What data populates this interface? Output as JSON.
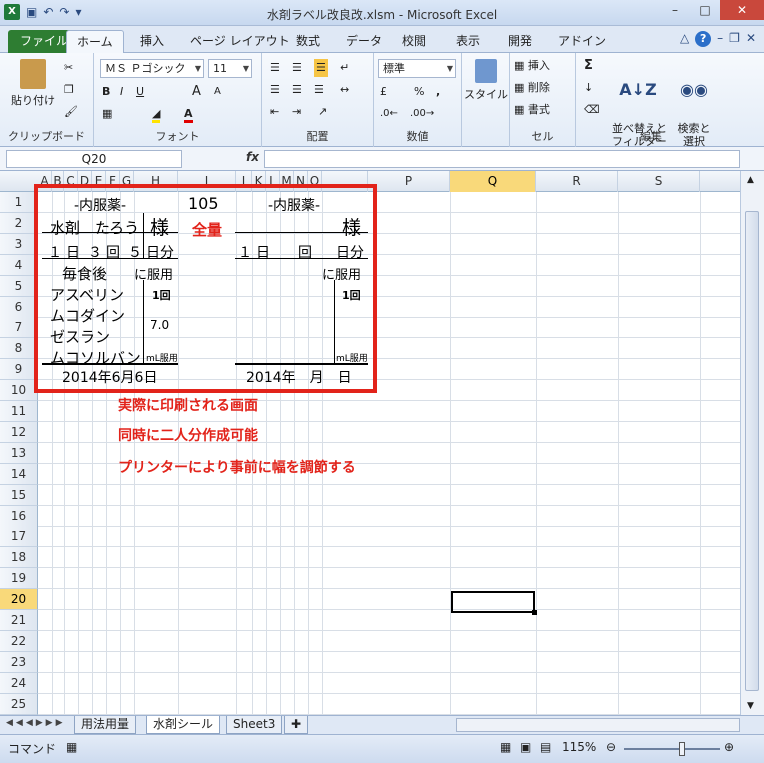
{
  "window": {
    "title": "水剤ラベル改良改.xlsm - Microsoft Excel",
    "app_icon": "X"
  },
  "qat": {
    "undo": "↶",
    "redo": "↷",
    "more": "▾"
  },
  "window_buttons": {
    "min": "–",
    "max": "□",
    "close": "✕"
  },
  "ribbon_tabs": [
    "ファイル",
    "ホーム",
    "挿入",
    "ページ レイアウト",
    "数式",
    "データ",
    "校閲",
    "表示",
    "開発",
    "アドイン"
  ],
  "ribbon": {
    "clipboard": {
      "title": "クリップボード",
      "paste": "貼り付け"
    },
    "font": {
      "title": "フォント",
      "name": "ＭＳ Ｐゴシック",
      "size": "11",
      "bold": "B",
      "italic": "I",
      "underline": "U",
      "grow": "A",
      "shrink": "A"
    },
    "align": {
      "title": "配置"
    },
    "number": {
      "title": "数値",
      "format": "標準",
      "percent": "%",
      "comma": ","
    },
    "styles": {
      "title": "",
      "label": "スタイル"
    },
    "cells": {
      "title": "セル",
      "insert": "挿入",
      "delete": "削除",
      "format": "書式"
    },
    "edit": {
      "title": "編集",
      "sum": "Σ",
      "sort": "並べ替えと\nフィルター",
      "find": "検索と\n選択"
    }
  },
  "formula": {
    "namebox": "Q20",
    "fx": "fx",
    "value": ""
  },
  "columns": [
    "A",
    "B",
    "C",
    "D",
    "E",
    "F",
    "G",
    "H",
    "I",
    "J",
    "K",
    "L",
    "M",
    "N",
    "O",
    "P",
    "Q",
    "R",
    "S"
  ],
  "selected_column": "Q",
  "rows": [
    "1",
    "2",
    "3",
    "4",
    "5",
    "6",
    "7",
    "8",
    "9",
    "10",
    "11",
    "12",
    "13",
    "14",
    "15",
    "16",
    "17",
    "18",
    "19",
    "20",
    "21",
    "22",
    "23",
    "24",
    "25"
  ],
  "selected_row": "20",
  "label_left": {
    "header": "-内服薬-",
    "patient": "水剤　たろう",
    "sama": "様",
    "dose_1": "１",
    "dose_day": "日",
    "dose_3": "３",
    "dose_kai": "回",
    "dose_5": "５",
    "dose_bun": "日分",
    "timing": "毎食後",
    "ni_fukuyo": "に服用",
    "drugs": [
      "アスベリン",
      "ムコダイン",
      "ゼスラン",
      "ムコソルバン"
    ],
    "per_dose": "1回",
    "amount": "7.0",
    "ml": "mL服用",
    "date": "2014年6月6日"
  },
  "middle": {
    "number": "105",
    "total": "全量"
  },
  "label_right": {
    "header": "-内服薬-",
    "sama": "様",
    "dose_1": "１",
    "dose_day": "日",
    "dose_kai": "回",
    "dose_bun": "日分",
    "ni_fukuyo": "に服用",
    "per_dose": "1回",
    "ml": "mL服用",
    "date": "2014年　月　日"
  },
  "notes": [
    "実際に印刷される画面",
    "同時に二人分作成可能",
    "プリンターにより事前に幅を調節する"
  ],
  "sheets": [
    "用法用量",
    "水剤シール",
    "Sheet3"
  ],
  "active_sheet": "水剤シール",
  "status": {
    "mode": "コマンド",
    "zoom": "115%",
    "zoom_fraction": 0.6
  }
}
